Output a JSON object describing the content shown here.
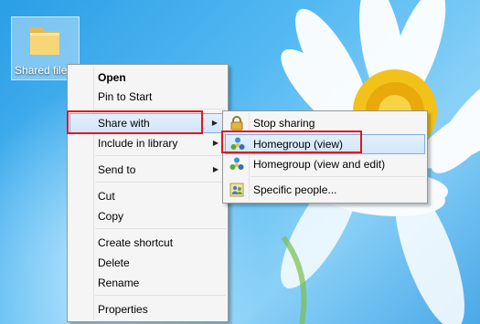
{
  "desktop": {
    "icon": {
      "label": "Shared file",
      "icon": "folder-icon"
    }
  },
  "context_menu": {
    "items": [
      {
        "label": "Open",
        "bold": true
      },
      {
        "label": "Pin to Start"
      },
      {
        "label": "Share with",
        "submenu": true,
        "highlighted": true
      },
      {
        "label": "Include in library",
        "submenu": true
      },
      {
        "label": "Send to",
        "submenu": true
      },
      {
        "label": "Cut"
      },
      {
        "label": "Copy"
      },
      {
        "label": "Create shortcut"
      },
      {
        "label": "Delete"
      },
      {
        "label": "Rename"
      },
      {
        "label": "Properties"
      }
    ]
  },
  "share_submenu": {
    "items": [
      {
        "label": "Stop sharing",
        "icon": "lock-icon"
      },
      {
        "label": "Homegroup (view)",
        "icon": "homegroup-icon",
        "highlighted": true
      },
      {
        "label": "Homegroup (view and edit)",
        "icon": "homegroup-icon"
      },
      {
        "label": "Specific people...",
        "icon": "people-icon"
      }
    ]
  },
  "colors": {
    "highlight_border": "#e1161f",
    "menu_bg": "#f5f5f5",
    "selection": "#d1e6f9"
  }
}
